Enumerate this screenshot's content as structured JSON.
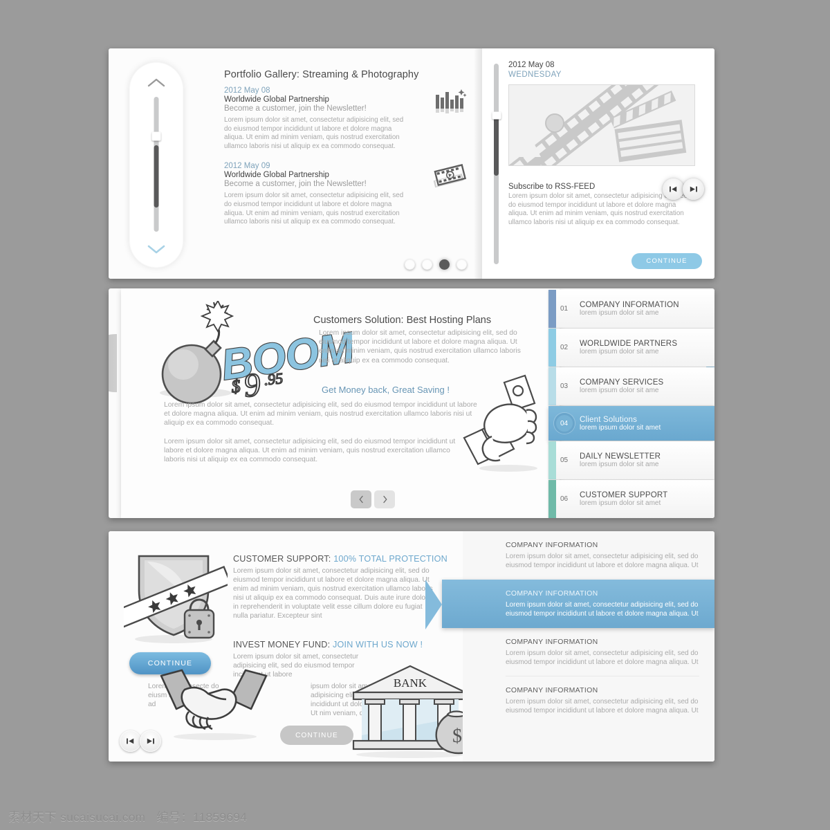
{
  "background_color": "#9b9b9b",
  "accent_blue": "#6ea8cd",
  "top_section": {
    "left_panel": {
      "slider": {
        "name": "vertical-scroll-slider",
        "value_percent": 36
      },
      "title": "Portfolio Gallery: Streaming & Photography",
      "news": [
        {
          "date": "2012 May 08",
          "headline": "Worldwide Global Partnership",
          "subhead": "Become a customer, join the Newsletter!",
          "body": "Lorem ipsum dolor sit amet, consectetur adipisicing elit, sed do eiusmod tempor incididunt ut labore et dolore magna aliqua. Ut enim ad minim veniam, quis nostrud exercitation ullamco laboris nisi ut aliquip ex ea commodo consequat.",
          "icon": "bar-chart-icon"
        },
        {
          "date": "2012 May 09",
          "headline": "Worldwide Global Partnership",
          "subhead": "Become a customer, join the Newsletter!",
          "body": "Lorem ipsum dolor sit amet, consectetur adipisicing elit, sed do eiusmod tempor incididunt ut labore et dolore magna aliqua. Ut enim ad minim veniam, quis nostrud exercitation ullamco laboris nisi ut aliquip ex ea commodo consequat.",
          "icon": "film-strip-play-icon"
        }
      ],
      "pagination": {
        "total": 4,
        "active_index": 3
      }
    },
    "right_panel": {
      "date": "2012 May 08",
      "weekday": "WEDNESDAY",
      "media_preview": "film-strip-clapperboard-image",
      "subscribe_title": "Subscribe to RSS-FEED",
      "body": "Lorem ipsum dolor sit amet, consectetur adipisicing elit, sed do eiusmod tempor incididunt ut labore et dolore magna aliqua. Ut enim ad minim veniam, quis nostrud exercitation ullamco laboris nisi ut aliquip ex ea commodo consequat.",
      "prev_icon": "skip-previous-icon",
      "next_icon": "skip-next-icon",
      "continue_label": "CONTINUE"
    }
  },
  "mid_section": {
    "left_tab_icon": "chevron-left-icon",
    "right_tab_icon": "chevron-right-icon",
    "bomb_icon": "bomb-icon",
    "boom_text": "BOOM",
    "price_text": "$9.95",
    "hand_money_icon": "hand-holding-money-icon",
    "title": "Customers Solution: Best Hosting Plans",
    "paragraph1": "Lorem ipsum dolor sit amet, consectetur adipisicing elit, sed do eiusmod tempor incididunt ut labore et dolore magna aliqua. Ut enim ad minim veniam, quis nostrud exercitation ullamco laboris nisi ut aliquip ex ea commodo consequat.",
    "highlight": "Get Money back, Great Saving !",
    "paragraph2": "Lorem ipsum dolor sit amet, consectetur adipisicing elit, sed do eiusmod tempor incididunt ut labore et dolore magna aliqua. Ut enim ad minim veniam, quis nostrud exercitation ullamco laboris nisi ut aliquip ex ea commodo consequat.",
    "paragraph3": "Lorem ipsum dolor sit amet, consectetur adipisicing elit, sed do eiusmod tempor incididunt ut labore et dolore magna aliqua. Ut enim ad minim veniam, quis nostrud exercitation ullamco laboris nisi ut aliquip ex ea commodo consequat.",
    "prev_icon": "chevron-left-icon",
    "next_icon": "chevron-right-icon",
    "accordion": [
      {
        "num": "01",
        "title": "COMPANY INFORMATION",
        "sub": "lorem ipsum dolor sit ame",
        "edge_color": "#7b9cc4",
        "active": false
      },
      {
        "num": "02",
        "title": "WORLDWIDE PARTNERS",
        "sub": "lorem ipsum dolor sit ame",
        "edge_color": "#8ecce4",
        "active": false
      },
      {
        "num": "03",
        "title": "COMPANY SERVICES",
        "sub": "lorem ipsum dolor sit ame",
        "edge_color": "#b8dde8",
        "active": false
      },
      {
        "num": "04",
        "title": "Client Solutions",
        "sub": "lorem ipsum dolor sit amet",
        "edge_color": "#6aa5cb",
        "active": true
      },
      {
        "num": "05",
        "title": "DAILY NEWSLETTER",
        "sub": "lorem ipsum dolor sit ame",
        "edge_color": "#a8ddd7",
        "active": false
      },
      {
        "num": "06",
        "title": "CUSTOMER SUPPORT",
        "sub": "lorem ipsum dolor sit amet",
        "edge_color": "#6fbaa8",
        "active": false
      }
    ]
  },
  "bot_section": {
    "shield_icon": "shield-stars-padlock-icon",
    "handshake_icon": "handshake-icon",
    "bank_icon": "bank-money-bag-icon",
    "bank_label": "BANK",
    "title_lead": "CUSTOMER SUPPORT: ",
    "title_accent": "100% TOTAL PROTECTION",
    "paragraph1": "Lorem ipsum dolor sit amet, consectetur adipisicing elit, sed do eiusmod tempor incididunt ut labore et dolore magna aliqua. Ut enim ad minim veniam, quis nostrud exercitation ullamco laboris nisi ut aliquip ex ea commodo consequat. Duis aute irure dolor in reprehenderit in voluptate velit esse cillum dolore eu fugiat nulla pariatur. Excepteur sint",
    "title2_lead": "INVEST MONEY FUND: ",
    "title2_accent": "JOIN WITH US NOW !",
    "paragraph2": "Lorem ipsum dolor sit amet, consectetur adipisicing elit, sed do eiusmod tempor incididunt ut labore",
    "paragraph3": "Lorem ips consecte do eiusm labore e enim ad",
    "paragraph4": "ipsum dolor sit amet, ctetur adipisicing elit, sed od tempor incididunt ut dolore magna aliqua. Ut nim veniam, quis exer oris nisi u",
    "continue_primary": "CONTINUE",
    "continue_secondary": "CONTINUE",
    "prev_icon": "skip-previous-icon",
    "next_icon": "skip-next-icon",
    "info_rows": [
      {
        "title": "COMPANY INFORMATION",
        "body": "Lorem ipsum dolor sit amet, consectetur adipisicing elit, sed do eiusmod tempor incididunt ut labore et dolore magna aliqua. Ut",
        "active": false
      },
      {
        "title": "COMPANY INFORMATION",
        "body": "Lorem ipsum dolor sit amet, consectetur adipisicing elit, sed do eiusmod tempor incididunt ut labore et dolore magna aliqua. Ut",
        "active": true
      },
      {
        "title": "COMPANY INFORMATION",
        "body": "Lorem ipsum dolor sit amet, consectetur adipisicing elit, sed do eiusmod tempor incididunt ut labore et dolore magna aliqua. Ut",
        "active": false
      },
      {
        "title": "COMPANY INFORMATION",
        "body": "Lorem ipsum dolor sit amet, consectetur adipisicing elit, sed do eiusmod tempor incididunt ut labore et dolore magna aliqua. Ut",
        "active": false
      }
    ]
  },
  "watermark": {
    "site": "素材天下 sucaisucai.com",
    "seq": "编号：11859694"
  }
}
